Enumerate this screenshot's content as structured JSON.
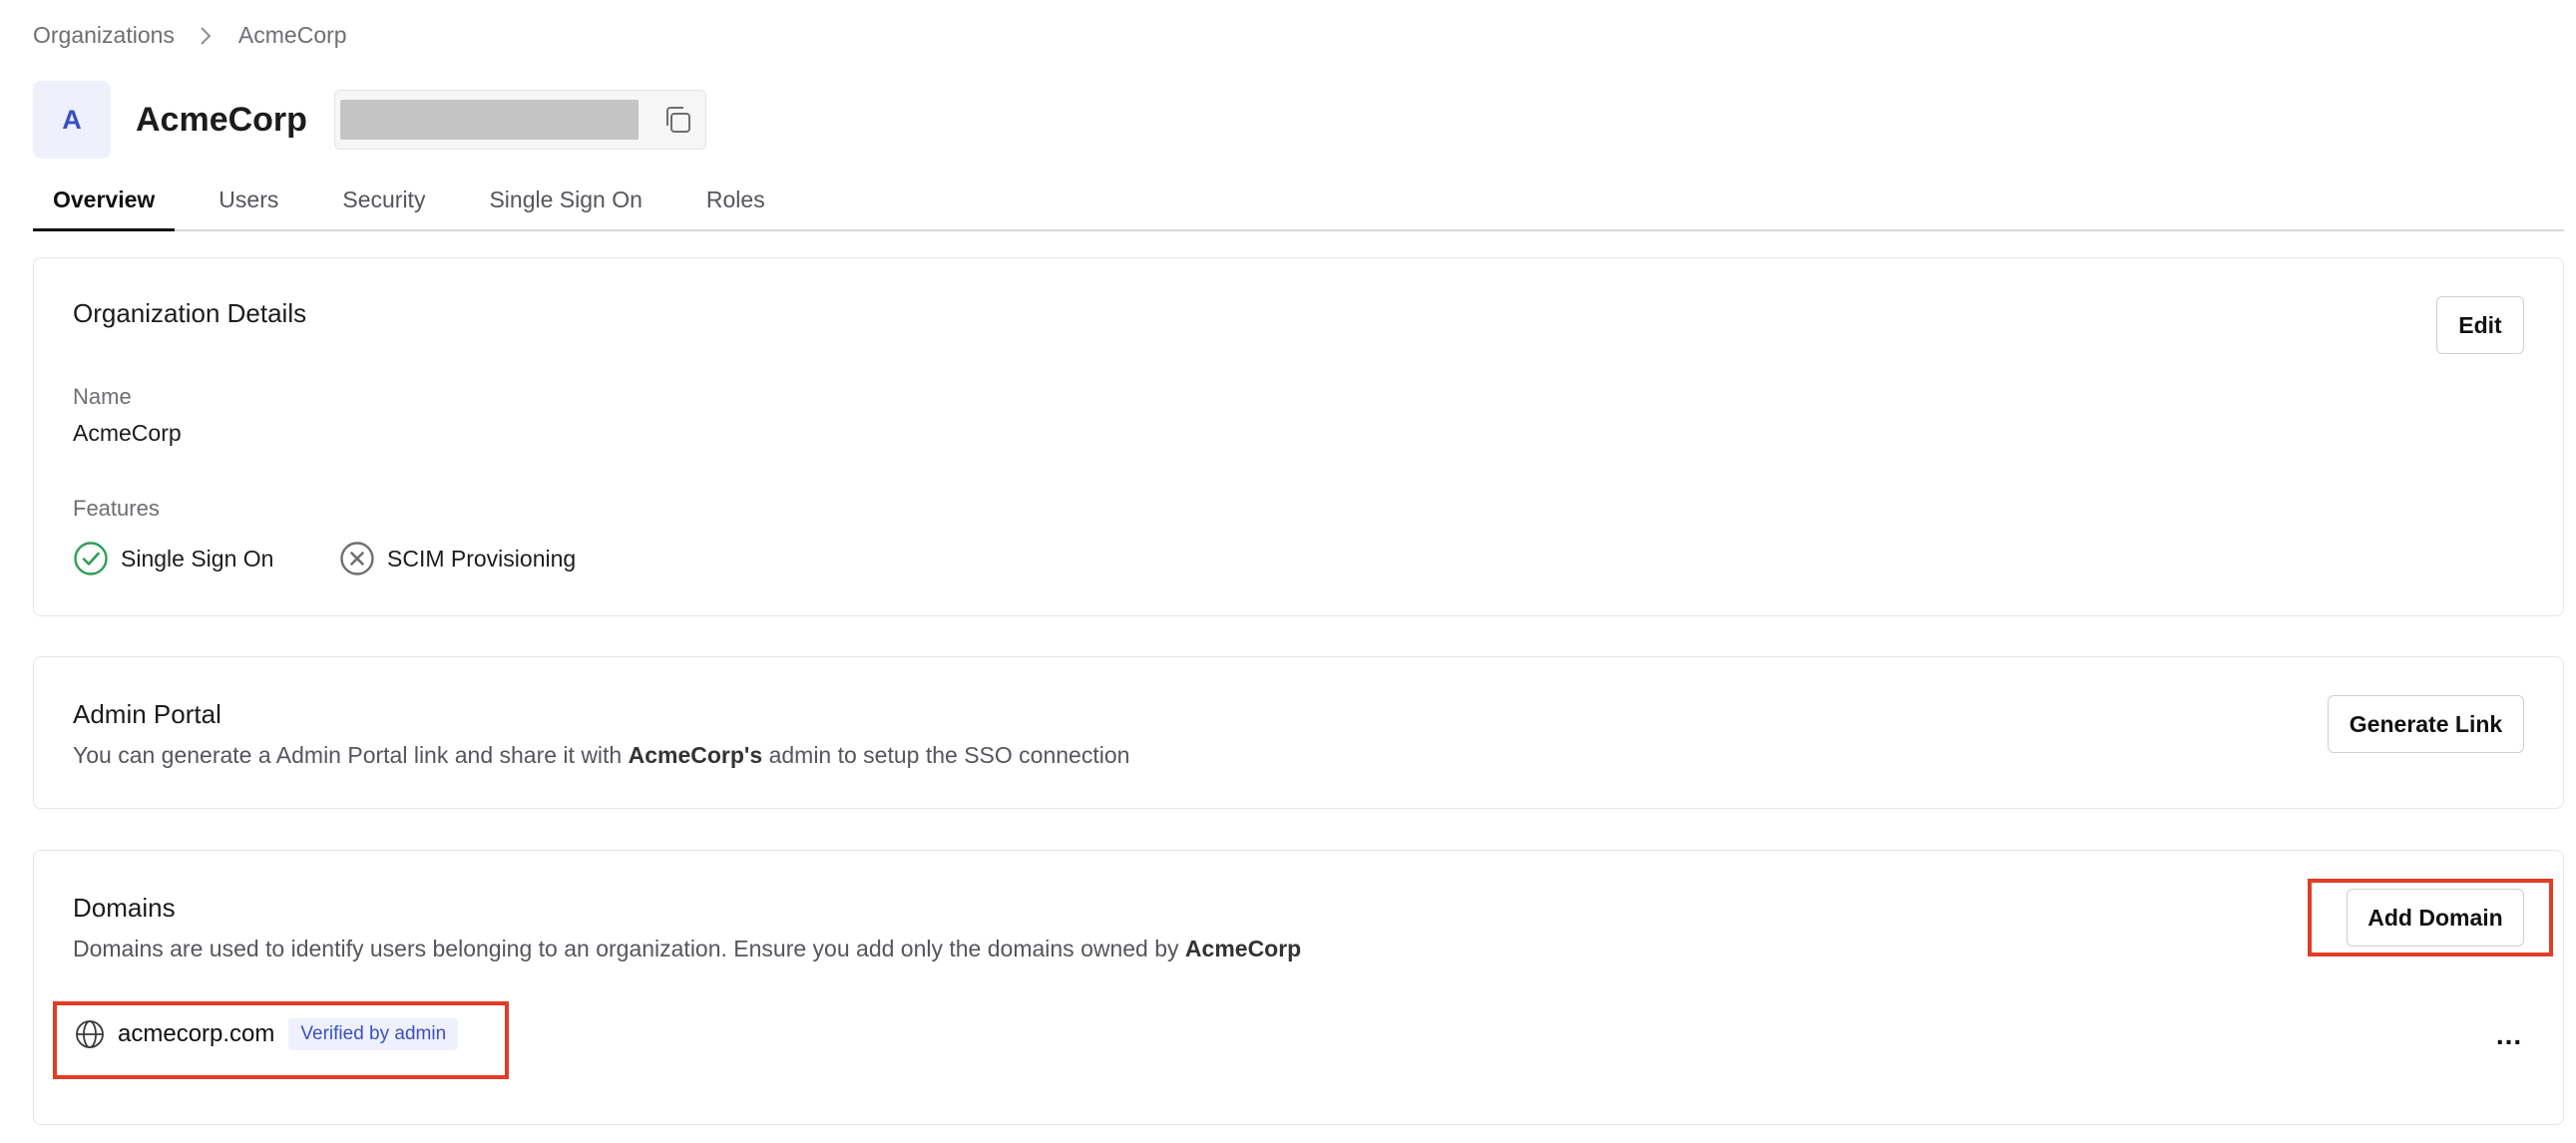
{
  "breadcrumb": {
    "parent": "Organizations",
    "current": "AcmeCorp"
  },
  "org": {
    "avatar_letter": "A",
    "name": "AcmeCorp",
    "copy_icon": "copy-icon"
  },
  "tabs": [
    {
      "label": "Overview",
      "active": true
    },
    {
      "label": "Users",
      "active": false
    },
    {
      "label": "Security",
      "active": false
    },
    {
      "label": "Single Sign On",
      "active": false
    },
    {
      "label": "Roles",
      "active": false
    }
  ],
  "details": {
    "title": "Organization Details",
    "edit_label": "Edit",
    "name_label": "Name",
    "name_value": "AcmeCorp",
    "features_label": "Features",
    "features": [
      {
        "label": "Single Sign On",
        "enabled": true,
        "icon": "check-circle-icon"
      },
      {
        "label": "SCIM Provisioning",
        "enabled": false,
        "icon": "x-circle-icon"
      }
    ]
  },
  "admin_portal": {
    "title": "Admin Portal",
    "desc_prefix": "You can generate a Admin Portal link and share it with ",
    "desc_bold": "AcmeCorp's",
    "desc_suffix": " admin to setup the SSO connection",
    "button_label": "Generate Link"
  },
  "domains": {
    "title": "Domains",
    "desc_prefix": "Domains are used to identify users belonging to an organization. Ensure you add only the domains owned by ",
    "desc_bold": "AcmeCorp",
    "add_label": "Add Domain",
    "items": [
      {
        "name": "acmecorp.com",
        "badge": "Verified by admin",
        "icon": "globe-icon"
      }
    ],
    "more_label": "..."
  },
  "colors": {
    "accent": "#3b4fc4",
    "success": "#2e9e55",
    "highlight": "#e23c26"
  }
}
